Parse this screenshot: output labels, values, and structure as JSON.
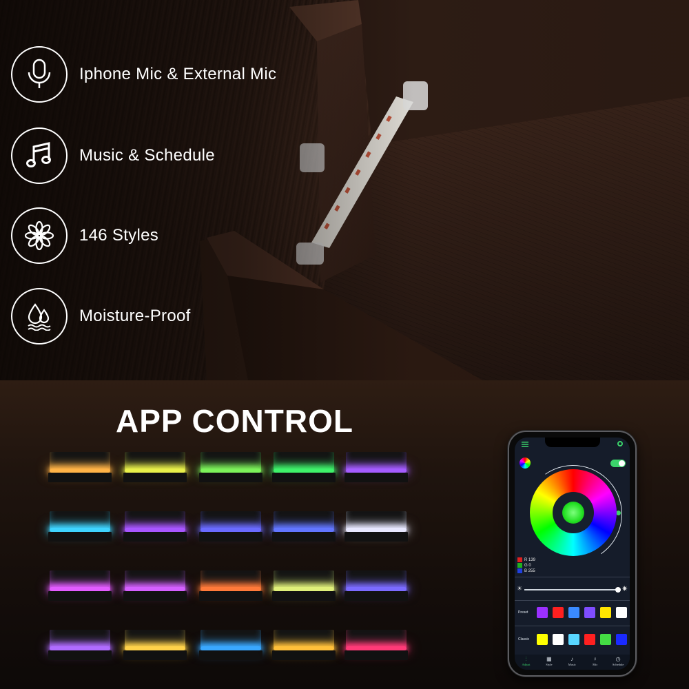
{
  "features": [
    {
      "label": "Iphone Mic & External Mic",
      "icon": "microphone-icon"
    },
    {
      "label": "Music & Schedule",
      "icon": "music-note-icon"
    },
    {
      "label": "146 Styles",
      "icon": "flower-icon"
    },
    {
      "label": "Moisture-Proof",
      "icon": "water-drops-icon"
    }
  ],
  "app_title": "APP CONTROL",
  "shelf_colors": [
    [
      "#ffb347",
      "#e8f04a",
      "#7cf25a",
      "#3ff26a",
      "#a45cff"
    ],
    [
      "#3fd4ff",
      "#a856ff",
      "#6a6bff",
      "#6276ff",
      "#e8e8ff"
    ],
    [
      "#e25cff",
      "#d460ff",
      "#ff7a3a",
      "#e0f07a",
      "#7b6bff"
    ],
    [
      "#b06cff",
      "#ffd24a",
      "#3aa8ff",
      "#ffc03a",
      "#ff3a78"
    ]
  ],
  "phone": {
    "rgb": [
      {
        "channel": "R",
        "value": "139",
        "color": "#e02020"
      },
      {
        "channel": "G",
        "value": "0",
        "color": "#20b020"
      },
      {
        "channel": "B",
        "value": "255",
        "color": "#2040e0"
      }
    ],
    "preset_label": "Preset",
    "classic_label": "Classic",
    "preset_colors": [
      "#9b30ff",
      "#ff2020",
      "#3a8aff",
      "#7f4dff",
      "#ffe400",
      "#ffffff"
    ],
    "classic_colors": [
      "#ffff00",
      "#ffffff",
      "#58d6ff",
      "#ff2020",
      "#44dd44",
      "#1a2aff"
    ],
    "tabs": [
      {
        "label": "Adjust",
        "icon": "sliders-icon",
        "active": true
      },
      {
        "label": "Style",
        "icon": "grid-icon",
        "active": false
      },
      {
        "label": "Music",
        "icon": "music-icon",
        "active": false
      },
      {
        "label": "Mic",
        "icon": "mic-icon",
        "active": false
      },
      {
        "label": "Schedule",
        "icon": "clock-icon",
        "active": false
      }
    ]
  }
}
